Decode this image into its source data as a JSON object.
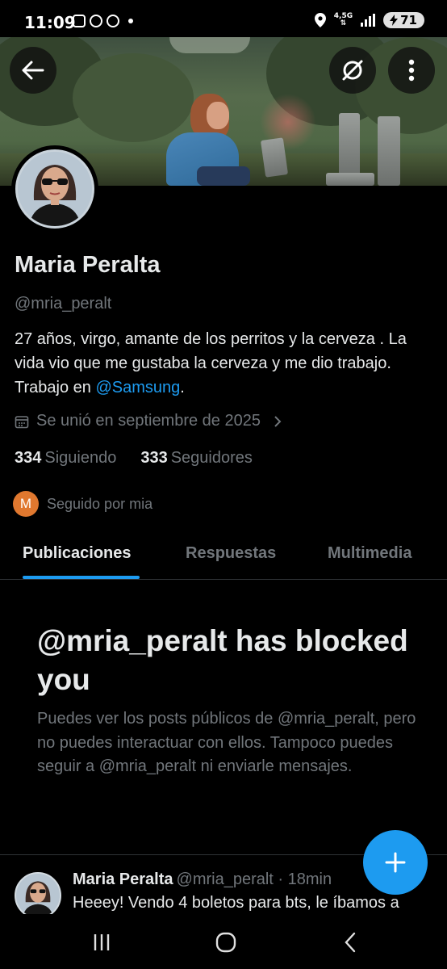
{
  "status_bar": {
    "time": "11:09",
    "network": "4,5G",
    "battery": "71"
  },
  "profile": {
    "name": "Maria Peralta",
    "handle": "@mria_peralt",
    "bio_text": "27 años, virgo, amante de los perritos y la cerveza . La vida vio que me gustaba la cerveza y me dio trabajo. Trabajo en ",
    "bio_mention": "@Samsung",
    "bio_end": ".",
    "joined": "Se unió en septiembre de 2025",
    "following_count": "334",
    "following_label": "Siguiendo",
    "followers_count": "333",
    "followers_label": "Seguidores",
    "followed_by_initial": "M",
    "followed_by": "Seguido por mia"
  },
  "tabs": {
    "posts": "Publicaciones",
    "replies": "Respuestas",
    "media": "Multimedia"
  },
  "blocked": {
    "title": "@mria_peralt has blocked you",
    "description": "Puedes ver los posts públicos de @mria_peralt, pero no puedes interactuar con ellos. Tampoco puedes seguir a @mria_peralt ni enviarle mensajes."
  },
  "post": {
    "name": "Maria Peralta",
    "meta": "@mria_peralt · 18min",
    "text": "Heeey! Vendo 4 boletos para bts, le íbamos a"
  },
  "colors": {
    "accent": "#1d9bf0",
    "background": "#000000",
    "muted_text": "#71767b"
  },
  "icons": [
    "back-arrow-icon",
    "mute-icon",
    "more-vertical-icon",
    "calendar-icon",
    "chevron-right-icon",
    "plus-icon",
    "recent-apps-icon",
    "home-icon",
    "nav-back-icon"
  ]
}
